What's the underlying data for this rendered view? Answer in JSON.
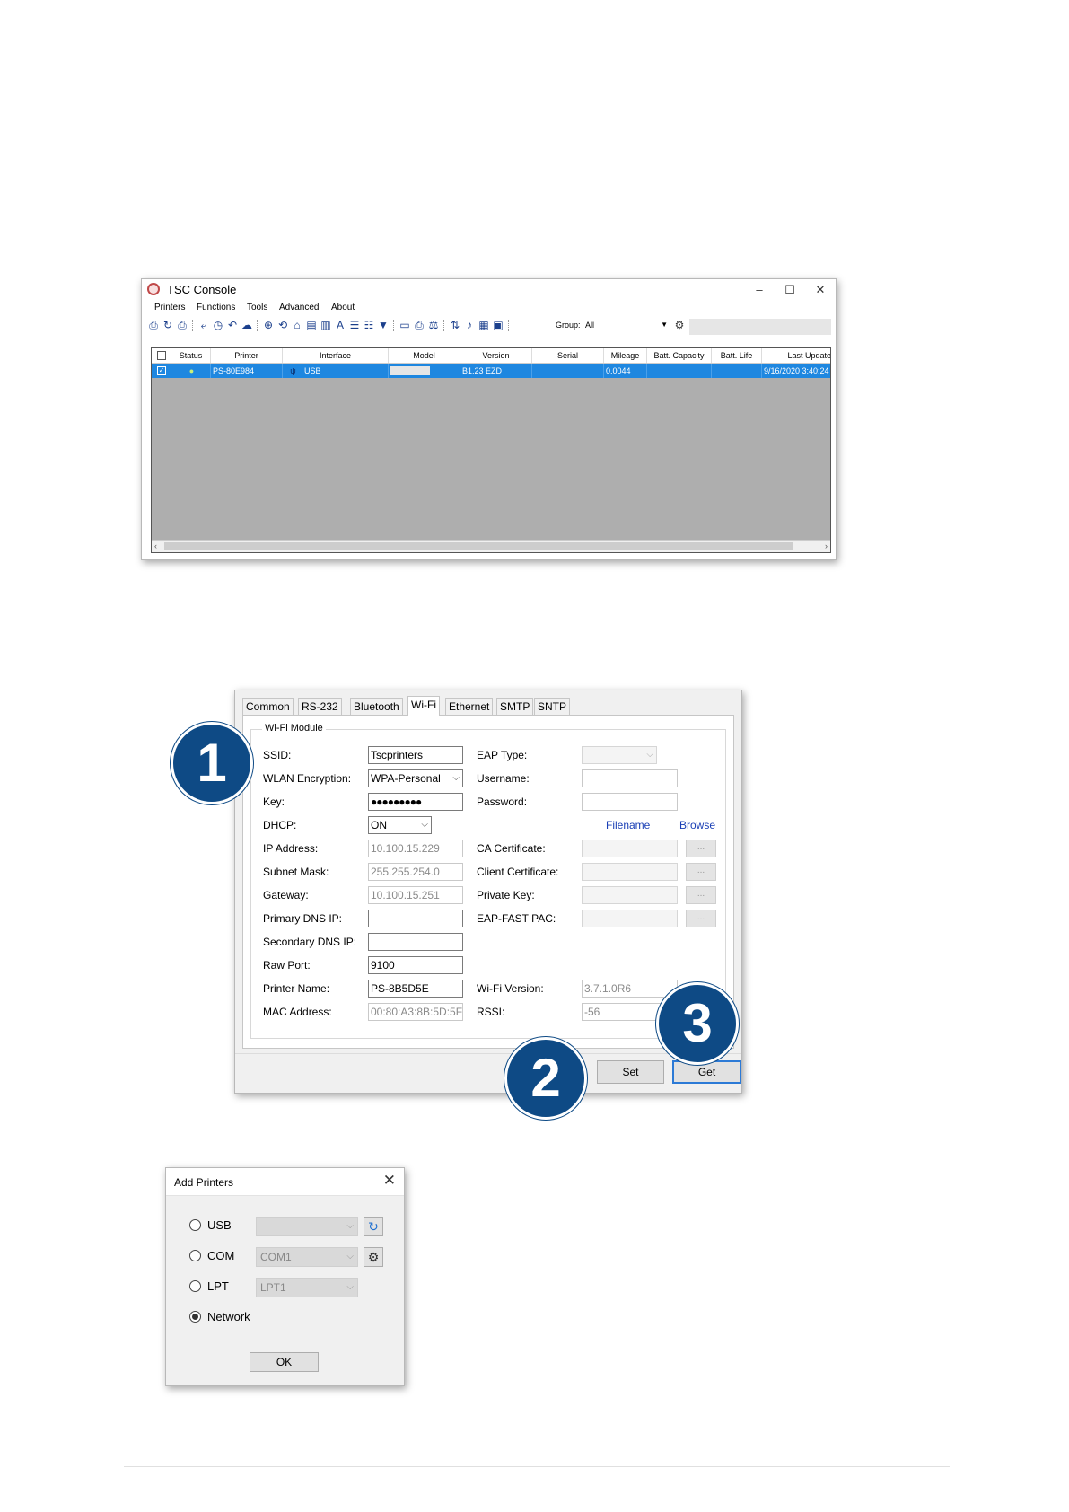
{
  "console": {
    "title": "TSC Console",
    "menu": [
      "Printers",
      "Functions",
      "Tools",
      "Advanced",
      "About"
    ],
    "group_label": "Group:",
    "group_value": "All",
    "columns": [
      "Status",
      "Printer",
      "Interface",
      "Model",
      "Version",
      "Serial",
      "Mileage",
      "Batt. Capacity",
      "Batt. Life",
      "Last Update"
    ],
    "row": {
      "printer": "PS-80E984",
      "interface": "USB",
      "version": "B1.23 EZD",
      "mileage": "0.0044",
      "last_update": "9/16/2020 3:40:24"
    },
    "window_controls": [
      "–",
      "☐",
      "✕"
    ]
  },
  "wifi": {
    "tabs": [
      "Common",
      "RS-232",
      "Bluetooth",
      "Wi-Fi",
      "Ethernet",
      "SMTP",
      "SNTP"
    ],
    "active_tab": "Wi-Fi",
    "group_title": "Wi-Fi Module",
    "labels": {
      "ssid": "SSID:",
      "wlan_enc": "WLAN Encryption:",
      "key": "Key:",
      "dhcp": "DHCP:",
      "ip": "IP Address:",
      "subnet": "Subnet Mask:",
      "gateway": "Gateway:",
      "dns1": "Primary DNS IP:",
      "dns2": "Secondary DNS IP:",
      "rawport": "Raw Port:",
      "printer_name": "Printer Name:",
      "mac": "MAC Address:",
      "eap_type": "EAP Type:",
      "username": "Username:",
      "password": "Password:",
      "ca_cert": "CA Certificate:",
      "client_cert": "Client Certificate:",
      "private_key": "Private Key:",
      "eap_fast": "EAP-FAST PAC:",
      "wifi_version": "Wi-Fi Version:",
      "rssi": "RSSI:"
    },
    "values": {
      "ssid": "Tscprinters",
      "wlan_enc": "WPA-Personal",
      "key": "●●●●●●●●●",
      "dhcp": "ON",
      "ip": "10.100.15.229",
      "subnet": "255.255.254.0",
      "gateway": "10.100.15.251",
      "dns1": "",
      "dns2": "",
      "rawport": "9100",
      "printer_name": "PS-8B5D5E",
      "mac": "00:80:A3:8B:5D:5F",
      "wifi_version": "3.7.1.0R6",
      "rssi": "-56"
    },
    "filename_link": "Filename",
    "browse_link": "Browse",
    "dots": "...",
    "set_label": "Set",
    "get_label": "Get"
  },
  "add_printers": {
    "title": "Add Printers",
    "close": "✕",
    "usb_label": "USB",
    "com_label": "COM",
    "com_value": "COM1",
    "lpt_label": "LPT",
    "lpt_value": "LPT1",
    "network_label": "Network",
    "selected": "Network",
    "ok_label": "OK"
  },
  "badges": [
    "1",
    "2",
    "3"
  ],
  "colors": {
    "badge": "#0e4a85",
    "selection": "#1e87e0",
    "link": "#1a3fb5",
    "focus_border": "#2c7ad6"
  }
}
